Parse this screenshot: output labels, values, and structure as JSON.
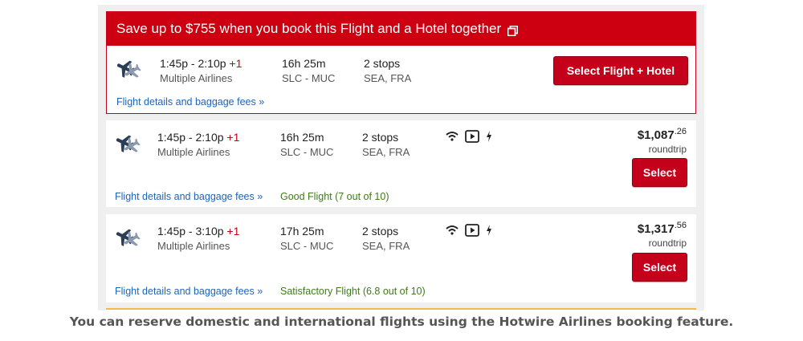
{
  "promo": {
    "banner": "Save up to $755 when you book this Flight and a Hotel together",
    "times": "1:45p - 2:10p",
    "day_offset": "+1",
    "airline": "Multiple Airlines",
    "duration": "16h 25m",
    "route": "SLC - MUC",
    "stops": "2 stops",
    "via": "SEA, FRA",
    "details_link": "Flight details and baggage fees",
    "button": "Select Flight + Hotel"
  },
  "flights": [
    {
      "times": "1:45p - 2:10p",
      "day_offset": "+1",
      "airline": "Multiple Airlines",
      "duration": "16h 25m",
      "route": "SLC - MUC",
      "stops": "2 stops",
      "via": "SEA, FRA",
      "price_main": "$1,087",
      "price_cents": ".26",
      "price_note": "roundtrip",
      "button": "Select",
      "details_link": "Flight details and baggage fees",
      "rating": "Good Flight (7 out of 10)",
      "amenities": [
        "wifi-icon",
        "video-icon",
        "power-icon"
      ]
    },
    {
      "times": "1:45p - 3:10p",
      "day_offset": "+1",
      "airline": "Multiple Airlines",
      "duration": "17h 25m",
      "route": "SLC - MUC",
      "stops": "2 stops",
      "via": "SEA, FRA",
      "price_main": "$1,317",
      "price_cents": ".56",
      "price_note": "roundtrip",
      "button": "Select",
      "details_link": "Flight details and baggage fees",
      "rating": "Satisfactory Flight (6.8 out of 10)",
      "amenities": [
        "wifi-icon",
        "video-icon",
        "power-icon"
      ]
    }
  ],
  "caption": "You can reserve domestic and international flights using the Hotwire Airlines booking feature.",
  "colors": {
    "brand_red": "#cc0011",
    "link_blue": "#1f63b5",
    "rating_green": "#3f7a1a"
  }
}
